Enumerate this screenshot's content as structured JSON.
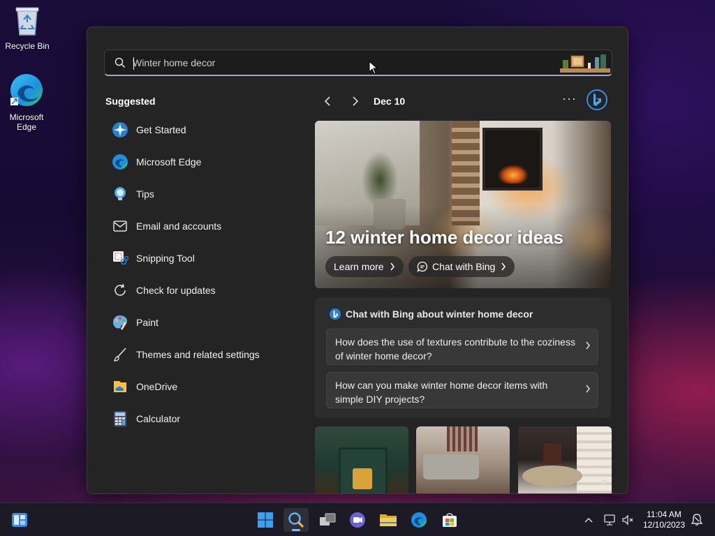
{
  "desktop": {
    "icons": [
      {
        "label": "Recycle Bin",
        "icon": "recycle-bin-icon"
      },
      {
        "label": "Microsoft Edge",
        "icon": "edge-icon"
      }
    ]
  },
  "search": {
    "value": "",
    "placeholder": "Winter home decor",
    "icon": "search-icon"
  },
  "suggested": {
    "title": "Suggested",
    "items": [
      {
        "label": "Get Started",
        "icon": "get-started-icon"
      },
      {
        "label": "Microsoft Edge",
        "icon": "edge-icon"
      },
      {
        "label": "Tips",
        "icon": "tips-icon"
      },
      {
        "label": "Email and accounts",
        "icon": "mail-icon"
      },
      {
        "label": "Snipping Tool",
        "icon": "snipping-tool-icon"
      },
      {
        "label": "Check for updates",
        "icon": "refresh-icon"
      },
      {
        "label": "Paint",
        "icon": "paint-icon"
      },
      {
        "label": "Themes and related settings",
        "icon": "brush-icon"
      },
      {
        "label": "OneDrive",
        "icon": "onedrive-icon"
      },
      {
        "label": "Calculator",
        "icon": "calculator-icon"
      }
    ]
  },
  "highlights": {
    "date": "Dec 10",
    "more": "···",
    "hero_title": "12 winter home decor ideas",
    "learn_more": "Learn more",
    "chat_with_bing": "Chat with Bing"
  },
  "chat_card": {
    "heading": "Chat with Bing about winter home decor",
    "questions": [
      "How does the use of textures contribute to the coziness of winter home decor?",
      "How can you make winter home decor items with simple DIY projects?"
    ]
  },
  "taskbar": {
    "apps": [
      "widgets-icon",
      "start-icon",
      "search-icon",
      "task-view-icon",
      "chat-icon",
      "file-explorer-icon",
      "edge-icon",
      "store-icon"
    ],
    "time": "11:04 AM",
    "date": "12/10/2023"
  },
  "colors": {
    "panel_bg": "#242424",
    "card_bg": "#2d2d2d",
    "accent": "#8ab4f8"
  }
}
